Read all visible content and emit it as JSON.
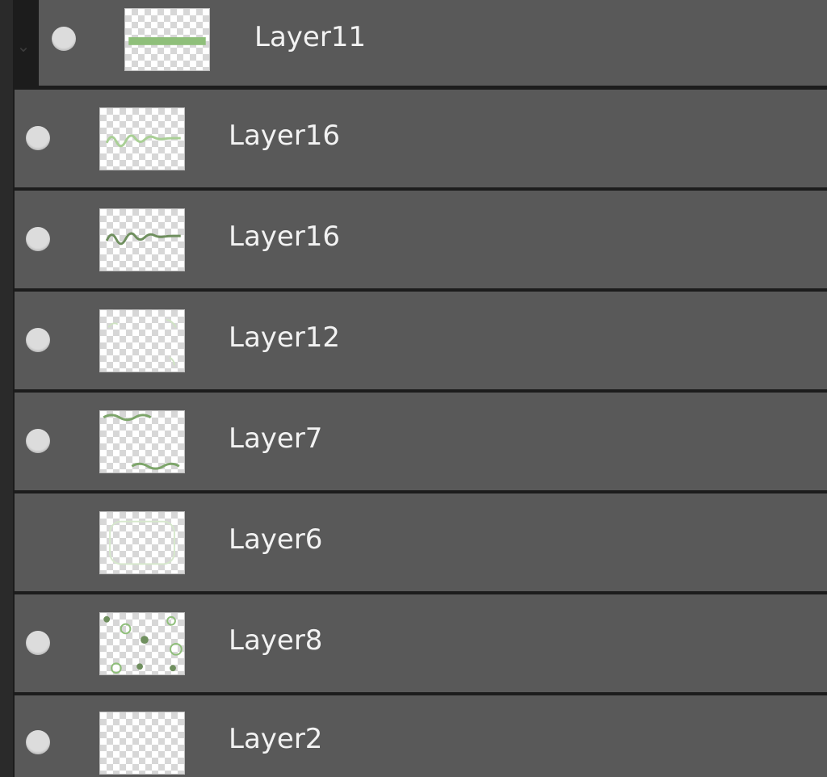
{
  "layers": [
    {
      "name": "Layer11",
      "visible": true,
      "thumbnail": "green-stripe",
      "child": true
    },
    {
      "name": "Layer16",
      "visible": true,
      "thumbnail": "green-script-light",
      "child": false
    },
    {
      "name": "Layer16",
      "visible": true,
      "thumbnail": "green-script-dark",
      "child": false
    },
    {
      "name": "Layer12",
      "visible": true,
      "thumbnail": "faint-green-corners",
      "child": false
    },
    {
      "name": "Layer7",
      "visible": true,
      "thumbnail": "green-waves",
      "child": false
    },
    {
      "name": "Layer6",
      "visible": false,
      "thumbnail": "faint-green-frame",
      "child": false
    },
    {
      "name": "Layer8",
      "visible": true,
      "thumbnail": "green-dots",
      "child": false
    },
    {
      "name": "Layer2",
      "visible": true,
      "thumbnail": "empty",
      "child": false
    }
  ],
  "icons": {
    "visibility": "eye-dot-icon",
    "group_toggle": "chevron-down-icon"
  },
  "colors": {
    "row_background": "#595959",
    "separator": "#1c1c1c",
    "thumbnail_green": "#8fbf7a",
    "thumbnail_dark_green": "#6f8f5e",
    "text": "#f2f2f2"
  }
}
